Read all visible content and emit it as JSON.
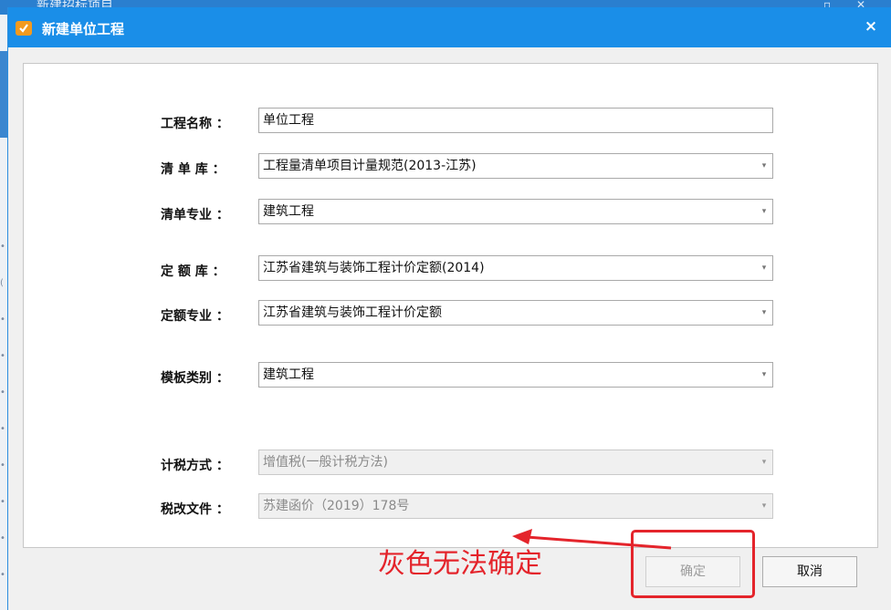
{
  "background_window": {
    "title": "新建招标项目"
  },
  "dialog": {
    "title": "新建单位工程",
    "close_label": "×"
  },
  "form": {
    "fields": [
      {
        "label": "工程名称 ：",
        "value": "单位工程",
        "type": "text",
        "enabled": true
      },
      {
        "label": "清 单 库 ：",
        "value": "工程量清单项目计量规范(2013-江苏)",
        "type": "select",
        "enabled": true
      },
      {
        "label": "清单专业 ：",
        "value": "建筑工程",
        "type": "select",
        "enabled": true
      },
      {
        "label": "定 额 库 ：",
        "value": "江苏省建筑与装饰工程计价定额(2014)",
        "type": "select",
        "enabled": true
      },
      {
        "label": "定额专业 ：",
        "value": "江苏省建筑与装饰工程计价定额",
        "type": "select",
        "enabled": true
      },
      {
        "label": "模板类别 ：",
        "value": "建筑工程",
        "type": "select",
        "enabled": true
      },
      {
        "label": "计税方式 ：",
        "value": "增值税(一般计税方法)",
        "type": "select",
        "enabled": false
      },
      {
        "label": "税改文件 ：",
        "value": "苏建函价（2019）178号",
        "type": "select",
        "enabled": false
      }
    ]
  },
  "buttons": {
    "ok_label": "确定",
    "cancel_label": "取消"
  },
  "annotation": {
    "text": "灰色无法确定",
    "color": "#e4242b"
  },
  "colors": {
    "titlebar": "#1a8ee8",
    "icon": "#f39a1e"
  }
}
